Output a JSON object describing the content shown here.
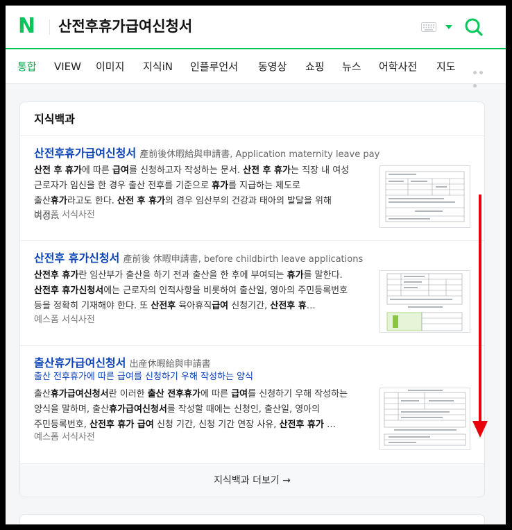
{
  "header": {
    "logo": "N",
    "query": "산전후휴가급여신청서"
  },
  "tabs": [
    "통합",
    "VIEW",
    "이미지",
    "지식iN",
    "인플루언서",
    "동영상",
    "쇼핑",
    "뉴스",
    "어학사전",
    "지도"
  ],
  "card": {
    "title": "지식백과",
    "more_label": "지식백과 더보기 →",
    "items": [
      {
        "title": "산전후휴가급여신청서",
        "subtitle": "產前後休暇給與申請書, Application maternity leave pay",
        "source": "비즈폼 서식사전"
      },
      {
        "title": "산전후 휴가신청서",
        "subtitle": "產前後 休暇申請書, before childbirth leave applications",
        "source": "예스폼 서식사전"
      },
      {
        "title": "출산휴가급여신청서",
        "subtitle": "出産休暇給與申請書",
        "summary": "출산 전후휴가에 따른 급여를 신청하기 우해 작성하는 양식",
        "source": "예스폼 서식사전"
      }
    ]
  },
  "colors": {
    "brand_green": "#03c75a",
    "link_blue": "#0c43b7",
    "annotation_red": "#e8000b"
  }
}
